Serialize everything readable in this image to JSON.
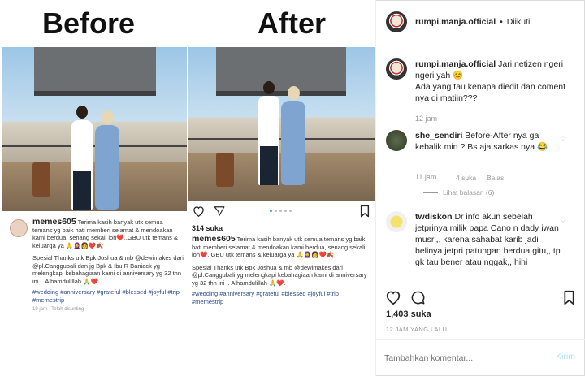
{
  "media": {
    "before_label": "Before",
    "after_label": "After",
    "left_caption": {
      "username": "memes605",
      "body": "Terima kasih banyak utk semua temans yg baik hati memberi selamat & mendoakan kami berdua, senang sekali loh❤️..GBU utk temans & keluarga ya 🙏🧕👩❤️🍂",
      "thanks": "Spesial Thanks utk Bpk Joshua & mb @dewimakes dari @pl.Canggubali dan jg Bpk & Ibu R Baniack yg melengkapi kebahagiaan kami di anniversary yg 32 thn ini .. Alhamdulillah 🙏❤️.",
      "tags": "#wedding #anniversary #grateful #blessed #joyful #trip #memestrip",
      "time": "19 jam · Telah disunting"
    },
    "right_caption": {
      "likes": "314 suka",
      "username": "memes605",
      "body": "Terima kasih banyak utk semua temans yg baik hati memberi selamat & mendoakan kami berdua, senang sekali loh❤️..GBU utk temans & keluarga ya 🙏🧕👩❤️🍂",
      "thanks": "Spesial Thanks utk Bpk Joshua & mb @dewimakes dari @pl.Canggubali yg melengkapi kebahagiaan kami di anniversary yg 32 thn ini .. Alhamdulillah 🙏❤️.",
      "tags": "#wedding #anniversary #grateful #blessed #joyful #trip #memestrip"
    }
  },
  "header": {
    "username": "rumpi.manja.official",
    "separator": "•",
    "follow_status": "Diikuti"
  },
  "comments": [
    {
      "username": "rumpi.manja.official",
      "text": "Jari netizen ngeri ngeri yah 😊",
      "text2": "Ada yang tau kenapa diedit dan coment nya di matiin???",
      "time": "12 jam"
    },
    {
      "username": "she_sendiri",
      "text": "Before-After nya ga kebalik min ? Bs aja sarkas nya 😂",
      "time": "11 jam",
      "likes": "4 suka",
      "reply": "Balas",
      "view_replies": "Lihat balasan (6)"
    },
    {
      "username": "twdiskon",
      "text": "Dr info akun sebelah jetprinya milik papa Cano n dady iwan musri,, karena sahabat karib jadi belinya jetpri patungan berdua gitu,, tp gk tau bener atau nggak,, hihi"
    }
  ],
  "post": {
    "likes": "1,403 suka",
    "date": "12 JAM YANG LALU"
  },
  "composer": {
    "placeholder": "Tambahkan komentar...",
    "submit": "Kirim"
  },
  "colors": {
    "link": "#3897f0",
    "submit_disabled": "#b2dffc",
    "muted": "#999999"
  }
}
